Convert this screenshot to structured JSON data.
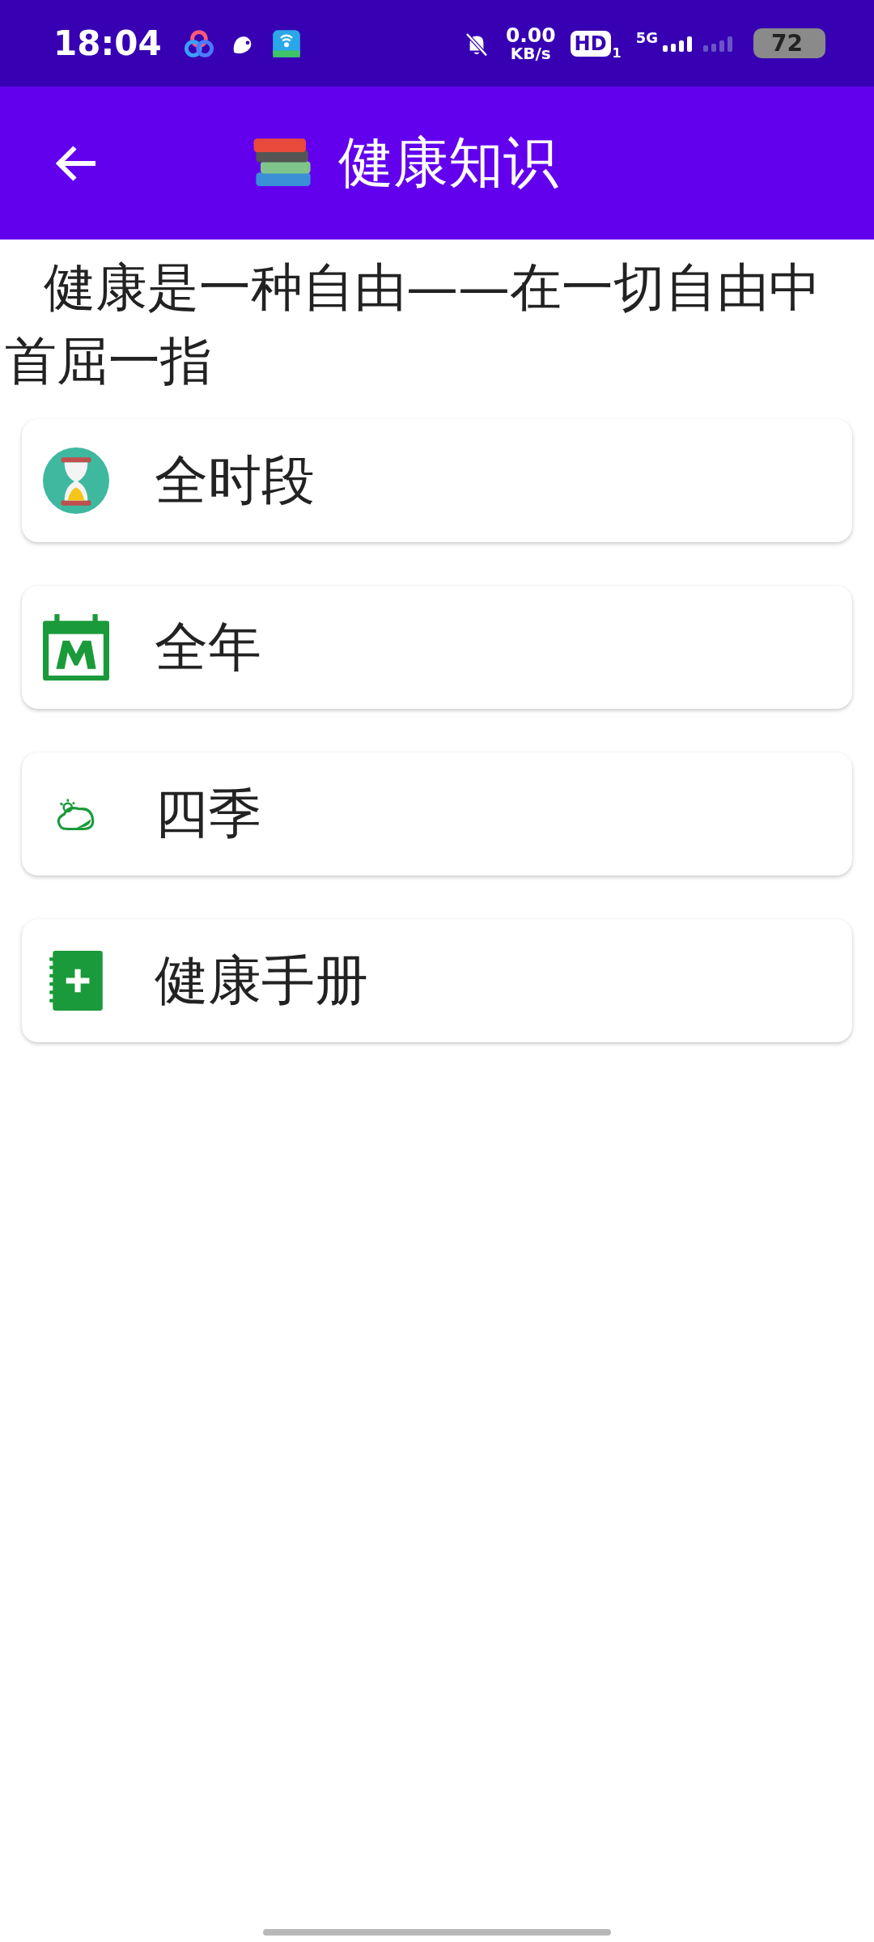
{
  "status_bar": {
    "time": "18:04",
    "net_speed": "0.00",
    "net_unit": "KB/s",
    "hd_label": "HD",
    "sim_index": "1",
    "network_type": "5G",
    "battery": "72"
  },
  "app_bar": {
    "title": "健康知识"
  },
  "quote": "健康是一种自由——在一切自由中首屈一指",
  "menu_items": [
    {
      "label": "全时段",
      "kind": "hourglass"
    },
    {
      "label": "全年",
      "kind": "calendar"
    },
    {
      "label": "四季",
      "kind": "weather"
    },
    {
      "label": "健康手册",
      "kind": "handbook"
    }
  ]
}
